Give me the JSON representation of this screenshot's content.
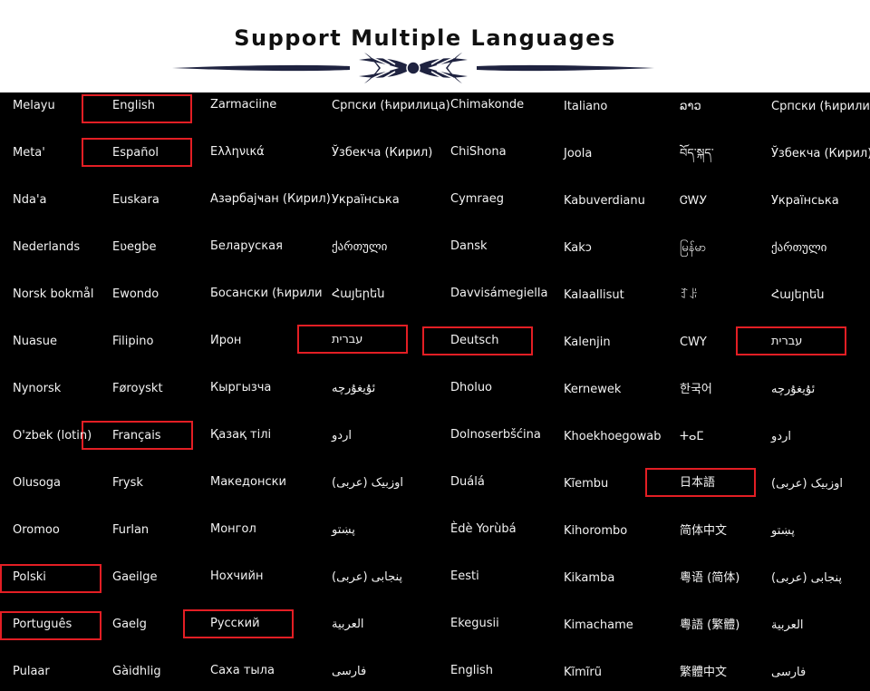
{
  "header": {
    "title": "Support Multiple Languages"
  },
  "columns": [
    [
      "Melayu",
      "Meta'",
      "Nda'a",
      "Nederlands",
      "Norsk bokmål",
      "Nuasue",
      "Nynorsk",
      "O'zbek (lotin)",
      "Olusoga",
      "Oromoo",
      "Polski",
      "Português",
      "Pulaar"
    ],
    [
      "English",
      "Español",
      "Euskara",
      "Eʋegbe",
      "Ewondo",
      "Filipino",
      "Føroyskt",
      "Français",
      "Frysk",
      "Furlan",
      "Gaeilge",
      "Gaelg",
      "Gàidhlig"
    ],
    [
      "Zarmaciine",
      "Ελληνικά",
      "Азәрбајҹан (Кирил)",
      "Беларуская",
      "Босански (ћирилица)",
      "Ирон",
      "Кыргызча",
      "Қазақ тілі",
      "Македонски",
      "Монгол",
      "Нохчийн",
      "Русский",
      "Саха тыла"
    ],
    [
      "Српски (ћирилица)",
      "Ўзбекча (Кирил)",
      "Українська",
      "ქართული",
      "Հայերեն",
      "עברית",
      "ئۇيغۇرچە",
      "اردو",
      "اوزبیک (عربی)",
      "پښتو",
      "پنجابی (عربی)",
      "العربية",
      "فارسی"
    ],
    [
      "Chimakonde",
      "ChiShona",
      "Cymraeg",
      "Dansk",
      "Davvisámegiella",
      "Deutsch",
      "Dholuo",
      "Dolnoserbšćina",
      "Duálá",
      "Èdè Yorùbá",
      "Eesti",
      "Ekegusii",
      "English"
    ],
    [
      "Italiano",
      "Joola",
      "Kabuverdianu",
      "Kakɔ",
      "Kalaallisut",
      "Kalenjin",
      "Kernewek",
      "Khoekhoegowab",
      "Kĩembu",
      "Kihorombo",
      "Kikamba",
      "Kimachame",
      "Kĩmĩrũ"
    ],
    [
      "ລາວ",
      "བོད་སྐད་",
      "ᏣᎳᎩ",
      "မြန်မာ",
      "ꆈꌠ",
      "CWY",
      "한국어",
      "ⵜⴰⵎ",
      "日本語",
      "简体中文",
      "粵语 (简体)",
      "粵語 (繁體)",
      "繁體中文"
    ],
    [
      "Српски (ћирилица)",
      "Ўзбекча (Кирил)",
      "Українська",
      "ქართული",
      "Հայերեն",
      "עברית",
      "ئۇيغۇرچە",
      "اردو",
      "اوزبیک (عربی)",
      "پښتو",
      "پنجابی (عربی)",
      "العربية",
      "فارسی"
    ]
  ]
}
